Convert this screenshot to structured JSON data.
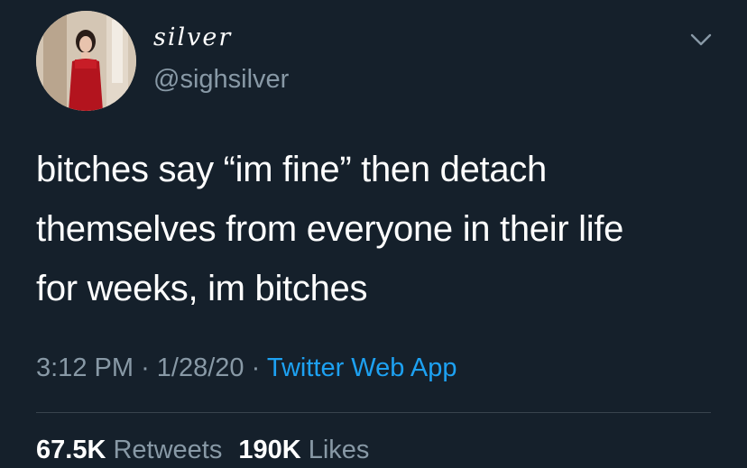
{
  "tweet": {
    "author": {
      "display_name": "silver",
      "handle": "@sighsilver",
      "avatar_icon": "profile-photo"
    },
    "text_lines": [
      "bitches say “im fine” then detach",
      "themselves from everyone in their life",
      "for weeks, im bitches"
    ],
    "time": "3:12 PM",
    "separator": "·",
    "date": "1/28/20",
    "source": "Twitter Web App",
    "stats": {
      "retweets_count": "67.5K",
      "retweets_label": "Retweets",
      "likes_count": "190K",
      "likes_label": "Likes"
    },
    "menu_icon": "chevron-down-icon"
  },
  "colors": {
    "background": "#15202b",
    "text": "#ffffff",
    "secondary": "#8899a6",
    "link": "#1da1f2",
    "divider": "#38444d"
  }
}
